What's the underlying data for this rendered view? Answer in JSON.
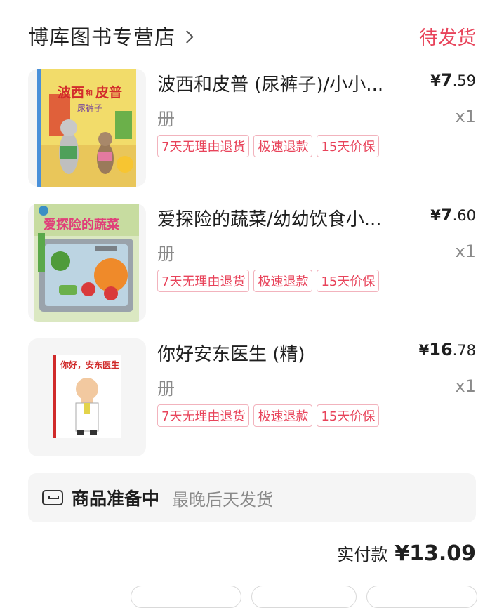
{
  "store": {
    "name": "博库图书专营店",
    "status": "待发货"
  },
  "items": [
    {
      "title": "波西和皮普 (尿裤子)/小小...",
      "price_symbol": "¥",
      "price_int": "7",
      "price_dec": ".59",
      "unit": "册",
      "qty": "x1",
      "tags": [
        "7天无理由退货",
        "极速退款",
        "15天价保"
      ],
      "cover": {
        "title_a": "波西",
        "title_b": "皮普",
        "title_mid": "和",
        "subtitle": "尿裤子"
      }
    },
    {
      "title": "爱探险的蔬菜/幼幼饮食小...",
      "price_symbol": "¥",
      "price_int": "7",
      "price_dec": ".60",
      "unit": "册",
      "qty": "x1",
      "tags": [
        "7天无理由退货",
        "极速退款",
        "15天价保"
      ],
      "cover": {
        "title": "爱探险的蔬菜"
      }
    },
    {
      "title": "你好安东医生 (精)",
      "price_symbol": "¥",
      "price_int": "16",
      "price_dec": ".78",
      "unit": "册",
      "qty": "x1",
      "tags": [
        "7天无理由退货",
        "极速退款",
        "15天价保"
      ],
      "cover": {
        "title": "你好，安东医生"
      }
    }
  ],
  "shipping": {
    "title": "商品准备中",
    "note": "最晚后天发货"
  },
  "total": {
    "label": "实付款",
    "amount": "¥13.09"
  },
  "colors": {
    "accent": "#e8435a",
    "tag_border": "#f2b3bd",
    "muted": "#8a8a8a"
  }
}
